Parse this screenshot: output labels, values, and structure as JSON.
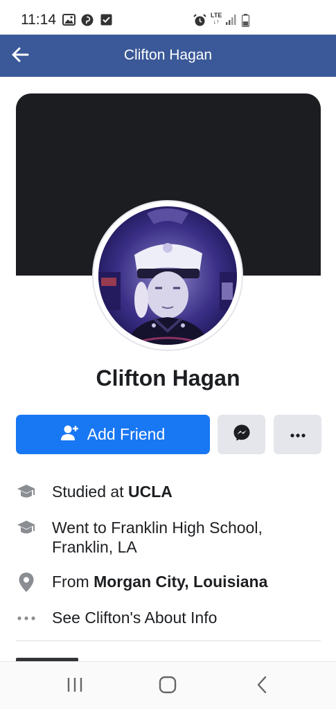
{
  "status_bar": {
    "time": "11:14",
    "network": "LTE",
    "icons": [
      "image-icon",
      "pinterest-icon",
      "checkbox-icon",
      "alarm-icon",
      "signal-icon",
      "battery-icon"
    ]
  },
  "header": {
    "title": "Clifton Hagan",
    "back_icon": "arrow-left-icon",
    "bg_color": "#3b5998"
  },
  "profile": {
    "name": "Clifton Hagan",
    "cover_color": "#1c1d21"
  },
  "actions": {
    "add_friend_label": "Add Friend",
    "add_friend_color": "#1877f2",
    "messenger_icon": "messenger-icon",
    "more_icon": "more-dots-icon"
  },
  "info": [
    {
      "icon": "graduation-cap-icon",
      "prefix": "Studied at ",
      "bold": "UCLA"
    },
    {
      "icon": "graduation-cap-icon",
      "line1": "Went to Franklin High School,",
      "line2": "Franklin, LA"
    },
    {
      "icon": "location-pin-icon",
      "prefix": "From ",
      "bold": "Morgan City, Louisiana"
    },
    {
      "icon": "more-dots-icon",
      "text": "See Clifton's About Info"
    }
  ],
  "nav": {
    "icons": [
      "recent-apps-icon",
      "home-icon",
      "back-icon"
    ]
  }
}
